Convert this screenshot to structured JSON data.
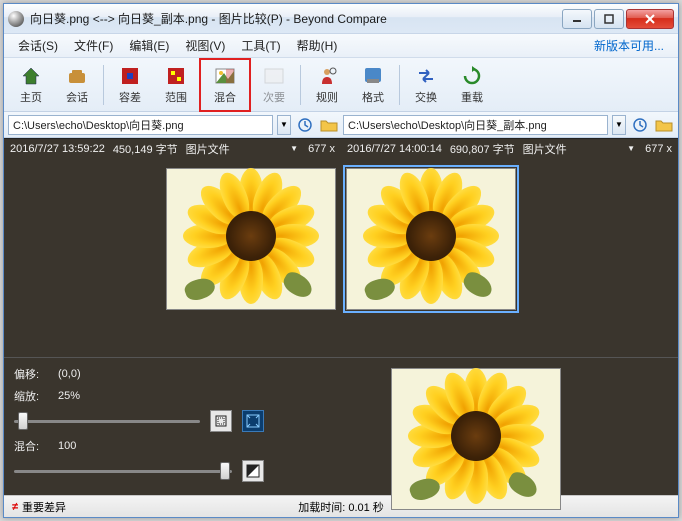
{
  "title": "向日葵.png <--> 向日葵_副本.png - 图片比较(P) - Beyond Compare",
  "menu": {
    "session": "会话(S)",
    "file": "文件(F)",
    "edit": "编辑(E)",
    "view": "视图(V)",
    "tools": "工具(T)",
    "help": "帮助(H)",
    "update": "新版本可用..."
  },
  "toolbar": {
    "home": "主页",
    "session": "会话",
    "tolerance": "容差",
    "range": "范围",
    "blend": "混合",
    "unchanged": "次要",
    "rules": "规则",
    "format": "格式",
    "swap": "交换",
    "reload": "重载"
  },
  "paths": {
    "left": "C:\\Users\\echo\\Desktop\\向日葵.png",
    "right": "C:\\Users\\echo\\Desktop\\向日葵_副本.png"
  },
  "stats": {
    "left": {
      "time": "2016/7/27 13:59:22",
      "bytes": "450,149 字节",
      "type": "图片文件",
      "dim": "677 x"
    },
    "right": {
      "time": "2016/7/27 14:00:14",
      "bytes": "690,807 字节",
      "type": "图片文件",
      "dim": "677 x"
    }
  },
  "controls": {
    "offset_label": "偏移:",
    "offset_value": "(0,0)",
    "zoom_label": "缩放:",
    "zoom_value": "25%",
    "blend_label": "混合:",
    "blend_value": "100"
  },
  "footer": {
    "diff": "重要差异",
    "load": "加载时间: 0.01 秒"
  }
}
